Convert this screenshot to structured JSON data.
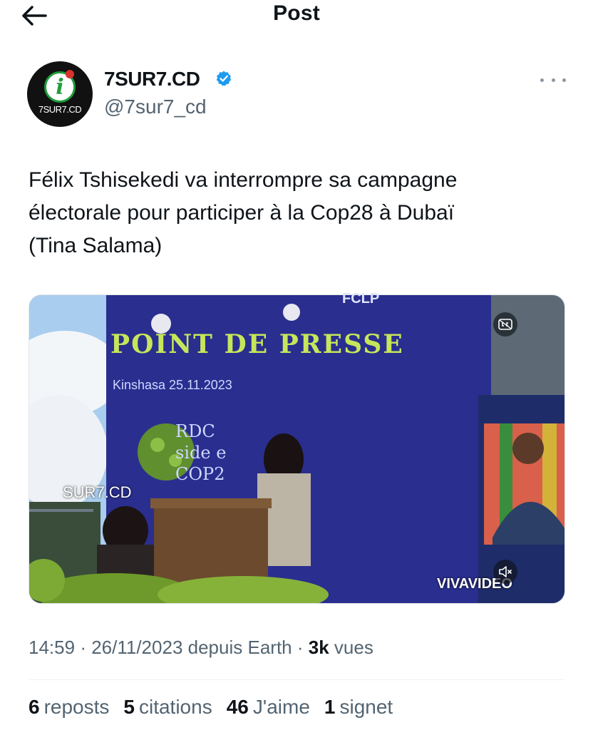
{
  "header": {
    "title": "Post",
    "back_icon": "arrow-left-icon"
  },
  "author": {
    "name": "7SUR7.CD",
    "handle": "@7sur7_cd",
    "avatar_text": "7SUR7.CD",
    "verified": true,
    "more_icon": "more-horizontal-icon"
  },
  "post": {
    "text": "Félix Tshisekedi va interrompre sa campagne\nélectorale pour participer à la Cop28 à Dubaï\n(Tina Salama)"
  },
  "media": {
    "banner_title": "POINT DE PRESSE",
    "banner_place": "Kinshasa 25.11.2023",
    "banner_rdc": "RDC\nside e\nCOP2",
    "banner_fclp": "FCLP",
    "watermark_left": "SUR7.CD",
    "watermark_right": "VIVAVIDEO",
    "cc_icon": "closed-captions-icon",
    "mute_icon": "volume-muted-icon"
  },
  "meta": {
    "time": "14:59",
    "date": "26/11/2023",
    "source": "depuis Earth",
    "views_count": "3k",
    "views_label": "vues"
  },
  "stats": {
    "reposts_count": "6",
    "reposts_label": "reposts",
    "quotes_count": "5",
    "quotes_label": "citations",
    "likes_count": "46",
    "likes_label": "J'aime",
    "bookmarks_count": "1",
    "bookmarks_label": "signet"
  },
  "colors": {
    "text_primary": "#0f1419",
    "text_secondary": "#536471",
    "verified_blue": "#1d9bf0",
    "banner_blue": "#2a2e8f",
    "banner_green": "#c6e65a"
  }
}
